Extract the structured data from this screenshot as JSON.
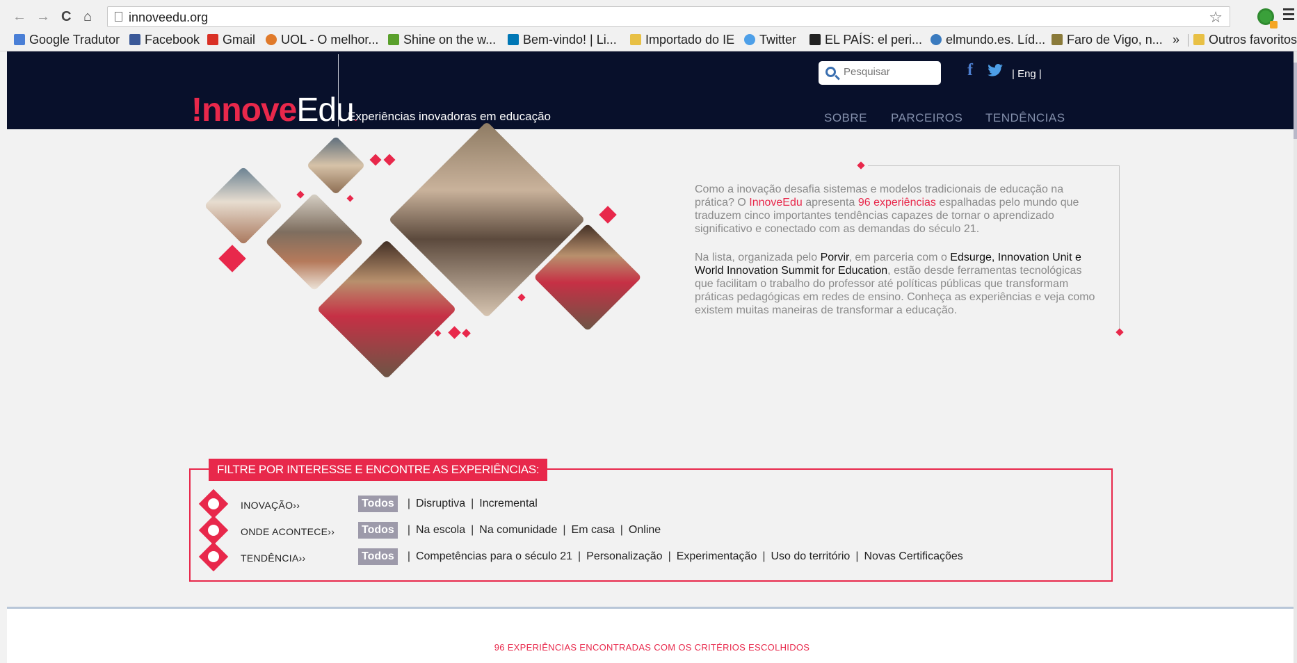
{
  "browser": {
    "url": "innoveedu.org",
    "bookmarks": [
      {
        "label": "Google Tradutor",
        "icon": "translate-icon",
        "color": "#4a7fd6"
      },
      {
        "label": "Facebook",
        "icon": "facebook-icon",
        "color": "#3b5998"
      },
      {
        "label": "Gmail",
        "icon": "gmail-icon",
        "color": "#d93025"
      },
      {
        "label": "UOL - O melhor...",
        "icon": "uol-icon",
        "color": "#e07a2a"
      },
      {
        "label": "Shine on the w...",
        "icon": "shine-icon",
        "color": "#5aa02c"
      },
      {
        "label": "Bem-vindo! | Li...",
        "icon": "linkedin-icon",
        "color": "#0077b5"
      },
      {
        "label": "Importado do IE",
        "icon": "folder-icon",
        "color": "#e8c045"
      },
      {
        "label": "Twitter",
        "icon": "twitter-icon",
        "color": "#4d9fe8"
      },
      {
        "label": "EL PAÍS: el peri...",
        "icon": "elpais-icon",
        "color": "#222222"
      },
      {
        "label": "elmundo.es. Líd...",
        "icon": "elmundo-icon",
        "color": "#3b7bbf"
      },
      {
        "label": "Faro de Vigo, n...",
        "icon": "farodevigo-icon",
        "color": "#8a7a3a"
      }
    ],
    "overflow": "»",
    "other_bookmarks": "Outros favoritos"
  },
  "header": {
    "logo_part1": "!nnove",
    "logo_part2": "Edu",
    "logo_dot": ".",
    "tagline": "Experiências inovadoras em educação",
    "search_placeholder": "Pesquisar",
    "facebook_glyph": "f",
    "lang": "| Eng |",
    "nav": [
      "SOBRE",
      "PARCEIROS",
      "TENDÊNCIAS"
    ]
  },
  "hero": {
    "p1": [
      "Como a inovação desafia sistemas e modelos tradicionais de educação na prática? O ",
      "InnoveEdu",
      " apresenta ",
      "96 experiências",
      " espalhadas pelo mundo que traduzem cinco importantes tendências capazes de tornar o aprendizado significativo e conectado com as demandas do século 21."
    ],
    "p2": [
      "Na lista, organizada pelo ",
      "Porvir",
      ", em parceria com o ",
      "Edsurge, Innovation Unit e World Innovation Summit for Education",
      ", estão desde ferramentas tecnológicas que facilitam o trabalho do professor até políticas públicas que transformam práticas pedagógicas em redes de ensino. Conheça as experiências e veja como existem muitas maneiras de transformar a educação."
    ]
  },
  "filter": {
    "title": "FILTRE POR INTERESSE E ENCONTRE AS EXPERIÊNCIAS:",
    "rows": [
      {
        "label": "INOVAÇÃO››",
        "all": "Todos",
        "options": [
          "Disruptiva",
          "Incremental"
        ]
      },
      {
        "label": "ONDE ACONTECE››",
        "all": "Todos",
        "options": [
          "Na escola",
          "Na comunidade",
          "Em casa",
          "Online"
        ]
      },
      {
        "label": "TENDÊNCIA››",
        "all": "Todos",
        "options": [
          "Competências para o século 21",
          "Personalização",
          "Experimentação",
          "Uso do território",
          "Novas Certificações"
        ]
      }
    ]
  },
  "results": {
    "count_text": "96 EXPERIÊNCIAS ENCONTRADAS COM OS CRITÉRIOS ESCOLHIDOS"
  },
  "colors": {
    "accent": "#e8284b",
    "header_bg": "#08102b",
    "nav_text": "#8591ad",
    "todos_bg": "#9d9aaa"
  }
}
